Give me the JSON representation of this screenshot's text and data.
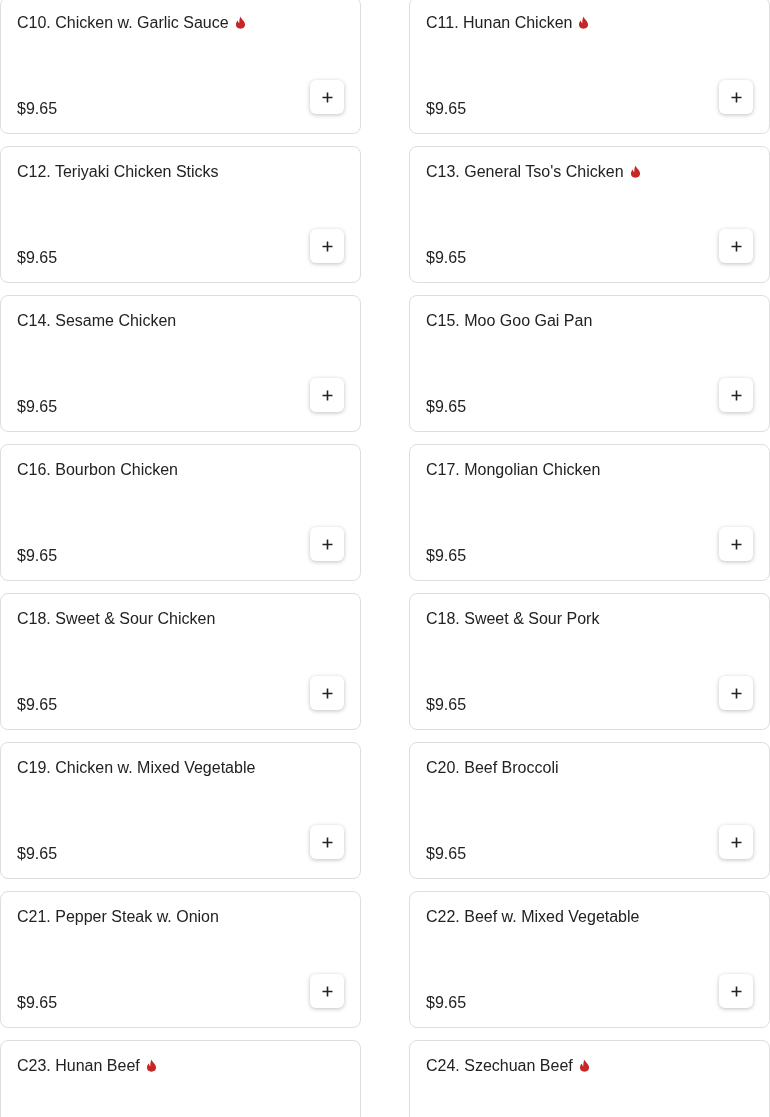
{
  "menu_items": [
    {
      "name": "C10. Chicken w. Garlic Sauce",
      "spicy": true,
      "price": "$9.65"
    },
    {
      "name": "C11. Hunan Chicken",
      "spicy": true,
      "price": "$9.65"
    },
    {
      "name": "C12. Teriyaki Chicken Sticks",
      "spicy": false,
      "price": "$9.65"
    },
    {
      "name": "C13. General Tso's Chicken",
      "spicy": true,
      "price": "$9.65"
    },
    {
      "name": "C14. Sesame Chicken",
      "spicy": false,
      "price": "$9.65"
    },
    {
      "name": "C15. Moo Goo Gai Pan",
      "spicy": false,
      "price": "$9.65"
    },
    {
      "name": "C16. Bourbon Chicken",
      "spicy": false,
      "price": "$9.65"
    },
    {
      "name": "C17. Mongolian Chicken",
      "spicy": false,
      "price": "$9.65"
    },
    {
      "name": "C18. Sweet & Sour Chicken",
      "spicy": false,
      "price": "$9.65"
    },
    {
      "name": "C18. Sweet & Sour Pork",
      "spicy": false,
      "price": "$9.65"
    },
    {
      "name": "C19. Chicken w. Mixed Vegetable",
      "spicy": false,
      "price": "$9.65"
    },
    {
      "name": "C20. Beef Broccoli",
      "spicy": false,
      "price": "$9.65"
    },
    {
      "name": "C21. Pepper Steak w. Onion",
      "spicy": false,
      "price": "$9.65"
    },
    {
      "name": "C22. Beef w. Mixed Vegetable",
      "spicy": false,
      "price": "$9.65"
    },
    {
      "name": "C23. Hunan Beef",
      "spicy": true
    },
    {
      "name": "C24. Szechuan Beef",
      "spicy": true
    }
  ]
}
